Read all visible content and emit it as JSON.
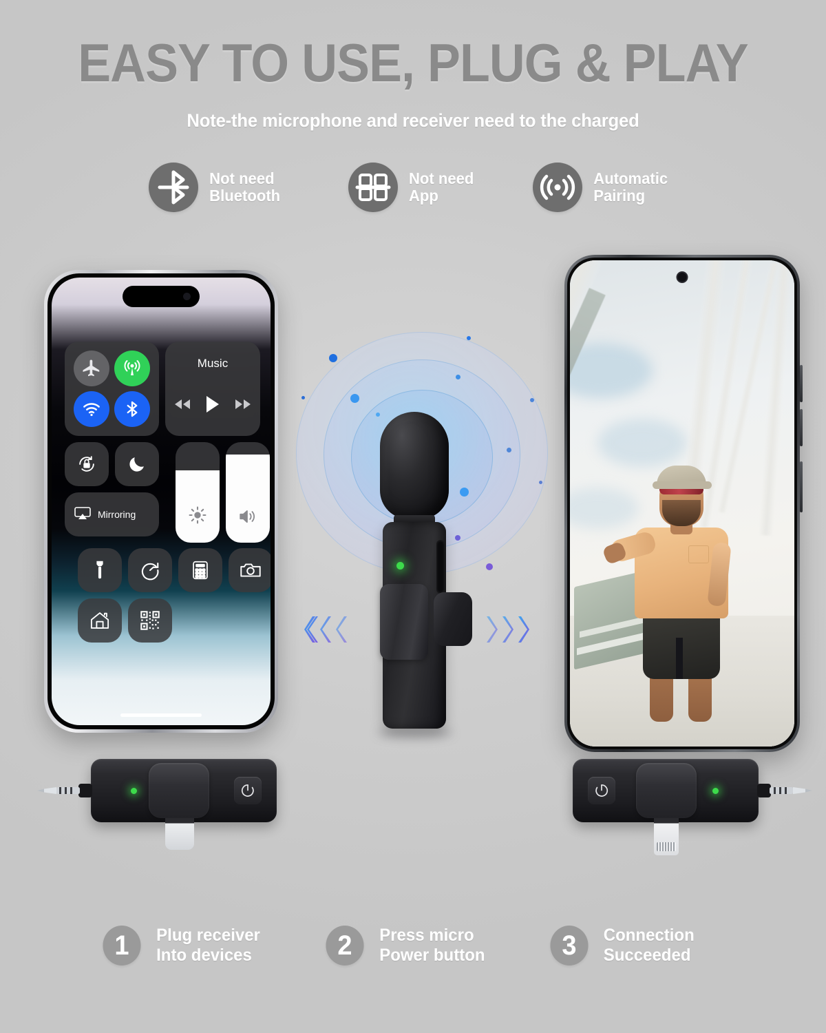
{
  "header": {
    "title": "EASY TO USE, PLUG & PLAY",
    "subtitle": "Note-the microphone and receiver need to the charged"
  },
  "colors": {
    "background": "#cdcdcd",
    "title_gray": "#8a8a8a",
    "icon_circle_gray": "#6e6e6e",
    "step_circle_gray": "#9a9a9a",
    "white_text": "#ffffff",
    "led_green": "#3ddb4b",
    "ios_blue": "#1b63f5",
    "ios_green": "#30d158",
    "ios_gray": "#636366",
    "ring_blue": "#4aa3ef",
    "chevron_blue": "#3ea6f0",
    "chevron_purple": "#7b5ce0"
  },
  "features": [
    {
      "icon": "bluetooth-disabled-icon",
      "label": "Not need\nBluetooth"
    },
    {
      "icon": "app-grid-disabled-icon",
      "label": "Not need\nApp"
    },
    {
      "icon": "wireless-signal-icon",
      "label": "Automatic\nPairing"
    }
  ],
  "iphone": {
    "device": "iPhone 14 Pro",
    "control_center": {
      "connectivity": [
        {
          "name": "airplane-mode",
          "icon": "airplane-icon",
          "state": "off"
        },
        {
          "name": "cellular-data",
          "icon": "cellular-icon",
          "state": "on"
        },
        {
          "name": "wifi",
          "icon": "wifi-icon",
          "state": "on"
        },
        {
          "name": "bluetooth",
          "icon": "bluetooth-icon",
          "state": "on"
        }
      ],
      "music_widget": {
        "label": "Music",
        "controls": [
          "rewind-icon",
          "play-icon",
          "fast-forward-icon"
        ]
      },
      "toggles": [
        {
          "name": "rotation-lock",
          "icon": "rotation-lock-icon"
        },
        {
          "name": "do-not-disturb",
          "icon": "moon-icon"
        }
      ],
      "screen_mirroring": {
        "label": "Mirroring",
        "icon": "airplay-icon"
      },
      "sliders": [
        {
          "name": "brightness",
          "icon": "brightness-icon",
          "value": 72
        },
        {
          "name": "volume",
          "icon": "volume-icon",
          "value": 88
        }
      ],
      "shortcuts": [
        {
          "name": "flashlight",
          "icon": "flashlight-icon"
        },
        {
          "name": "timer",
          "icon": "timer-icon"
        },
        {
          "name": "calculator",
          "icon": "calculator-icon"
        },
        {
          "name": "camera",
          "icon": "camera-icon"
        },
        {
          "name": "home",
          "icon": "home-icon"
        },
        {
          "name": "qr-scanner",
          "icon": "qr-code-icon"
        }
      ]
    }
  },
  "android": {
    "device": "Android smartphone",
    "screen_content": "man wearing cap, red sunglasses, peach t-shirt and dark shorts walking on a bright walkway"
  },
  "microphone": {
    "name": "wireless lavalier microphone",
    "led": "green",
    "rings": 3,
    "arrows": {
      "left": "❮❮❮",
      "right": "❯❯❯"
    }
  },
  "receivers": [
    {
      "name": "usb-c-receiver",
      "connector": "USB-C",
      "jack": "3.5mm",
      "jack_side": "left",
      "power_button_icon": "power-icon",
      "led": "green"
    },
    {
      "name": "lightning-receiver",
      "connector": "Lightning",
      "jack": "3.5mm",
      "jack_side": "right",
      "power_button_icon": "power-icon",
      "led": "green"
    }
  ],
  "steps": [
    {
      "number": "1",
      "label": "Plug receiver\nInto devices"
    },
    {
      "number": "2",
      "label": "Press micro\nPower button"
    },
    {
      "number": "3",
      "label": "Connection\nSucceeded"
    }
  ]
}
